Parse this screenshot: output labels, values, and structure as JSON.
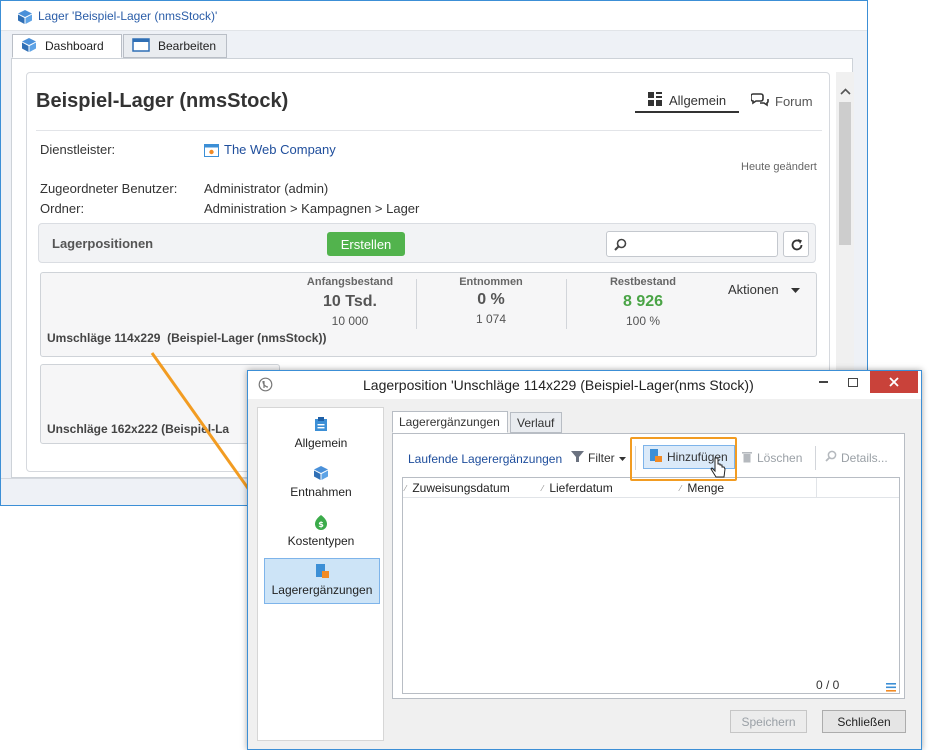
{
  "main": {
    "title": "Lager 'Beispiel-Lager (nmsStock)'",
    "tabs": [
      {
        "label": "Dashboard"
      },
      {
        "label": "Bearbeiten"
      }
    ],
    "heading": "Beispiel-Lager (nmsStock)",
    "subtabs": [
      {
        "label": "Allgemein"
      },
      {
        "label": "Forum"
      }
    ],
    "fields": {
      "provider_label": "Dienstleister:",
      "provider_value": "The Web Company",
      "changed": "Heute geändert",
      "user_label": "Zugeordneter Benutzer:",
      "user_value": "Administrator (admin)",
      "folder_label": "Ordner:",
      "folder_value": "Administration > Kampagnen > Lager"
    },
    "lager": {
      "title": "Lagerpositionen",
      "create_label": "Erstellen",
      "search_placeholder": ""
    },
    "items": [
      {
        "name": "Umschläge 114x229  (Beispiel-Lager (nmsStock))",
        "stats": [
          {
            "label": "Anfangsbestand",
            "main": "10 Tsd.",
            "sub": "10 000"
          },
          {
            "label": "Entnommen",
            "main": "0 %",
            "sub": "1 074"
          },
          {
            "label": "Restbestand",
            "main": "8 926",
            "sub": "100 %"
          }
        ],
        "actions": "Aktionen"
      },
      {
        "name": "Unschläge 162x222 (Beispiel-La"
      }
    ]
  },
  "dialog": {
    "title": "Lagerposition 'Unschläge 114x229 (Beispiel-Lager(nms Stock))",
    "nav": [
      {
        "label": "Allgemein"
      },
      {
        "label": "Entnahmen"
      },
      {
        "label": "Kostentypen"
      },
      {
        "label": "Lagerergänzungen"
      }
    ],
    "tabs": [
      {
        "label": "Lagerergänzungen"
      },
      {
        "label": "Verlauf"
      }
    ],
    "toolbar": {
      "running": "Laufende Lagerergänzungen",
      "filter": "Filter",
      "add": "Hinzufügen",
      "delete": "Löschen",
      "details": "Details..."
    },
    "columns": [
      "Zuweisungsdatum",
      "Lieferdatum",
      "Menge"
    ],
    "count": "0 / 0",
    "save": "Speichern",
    "close": "Schließen"
  },
  "colors": {
    "accent": "#3c8fd6",
    "green": "#52b34d",
    "highlight": "#f28b25",
    "link": "#1f4e9c"
  }
}
